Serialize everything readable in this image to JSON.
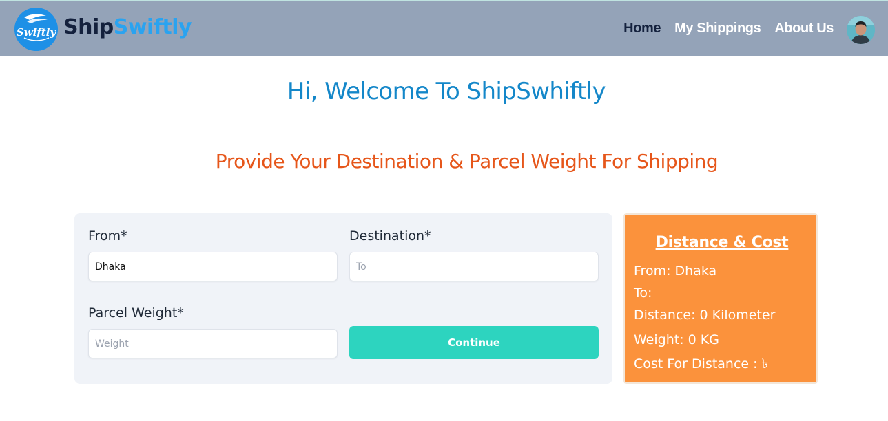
{
  "brand": {
    "logo_text": "Swiftly",
    "name_part1": "Ship",
    "name_part2": "Swiftly"
  },
  "nav": {
    "items": [
      {
        "label": "Home",
        "active": true
      },
      {
        "label": "My Shippings",
        "active": false
      },
      {
        "label": "About Us",
        "active": false
      }
    ]
  },
  "main": {
    "welcome": "Hi, Welcome To ShipSwhiftly",
    "subtitle": "Provide Your Destination & Parcel Weight For Shipping"
  },
  "form": {
    "from_label": "From*",
    "from_value": "Dhaka",
    "destination_label": "Destination*",
    "destination_placeholder": "To",
    "weight_label": "Parcel Weight*",
    "weight_placeholder": "Weight",
    "continue_label": "Continue"
  },
  "summary": {
    "title": "Distance & Cost",
    "from": "From: Dhaka",
    "to": "To:",
    "distance": "Distance: 0 Kilometer",
    "weight": "Weight: 0 KG",
    "cost": "Cost For Distance : ৳"
  },
  "colors": {
    "navbar": "#94a3b8",
    "accent_blue": "#1487c9",
    "accent_orange": "#e6561a",
    "button": "#2dd4bf",
    "summary_card": "#fb923c"
  },
  "icons": {
    "logo": "swiftly-wave-logo",
    "avatar": "user-avatar"
  }
}
